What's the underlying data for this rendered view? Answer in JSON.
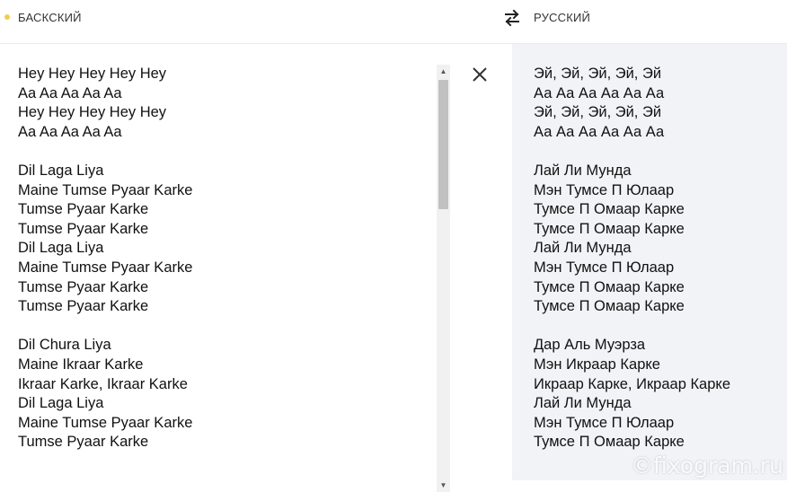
{
  "header": {
    "source_lang": "БАСКСКИЙ",
    "target_lang": "РУССКИЙ"
  },
  "source": {
    "lines": [
      "Hey Hey Hey Hey Hey",
      "Aa Aa Aa Aa Aa",
      "Hey Hey Hey Hey Hey",
      "Aa Aa Aa Aa Aa",
      "",
      "Dil Laga Liya",
      "Maine Tumse Pyaar Karke",
      "Tumse Pyaar Karke",
      "Tumse Pyaar Karke",
      "Dil Laga Liya",
      "Maine Tumse Pyaar Karke",
      "Tumse Pyaar Karke",
      "Tumse Pyaar Karke",
      "",
      "Dil Chura Liya",
      "Maine Ikraar Karke",
      "Ikraar Karke, Ikraar Karke",
      "Dil Laga Liya",
      "Maine Tumse Pyaar Karke",
      "Tumse Pyaar Karke"
    ]
  },
  "translation": {
    "lines": [
      "Эй, Эй, Эй, Эй, Эй",
      "Аа Аа Аа Аа Аа Аа",
      "Эй, Эй, Эй, Эй, Эй",
      "Аа Аа Аа Аа Аа Аа",
      "",
      "Лай Ли Мунда",
      "Мэн Тумсе П Юлаар",
      "Тумсе П Омаар Карке",
      "Тумсе П Омаар Карке",
      "Лай Ли Мунда",
      "Мэн Тумсе П Юлаар",
      "Тумсе П Омаар Карке",
      "Тумсе П Омаар Карке",
      "",
      "Дар Аль Муэрза",
      "Мэн Икраар Карке",
      "Икраар Карке, Икраар Карке",
      "Лай Ли Мунда",
      "Мэн Тумсе П Юлаар",
      "Тумсе П Омаар Карке"
    ]
  },
  "watermark": "©fixogram.ru",
  "colors": {
    "accent_dot": "#f4cc4b",
    "target_background": "#f2f3f7"
  },
  "icons": {
    "swap": "swap-arrows-icon",
    "close": "close-icon",
    "scroll_up": "triangle-up-icon",
    "scroll_down": "triangle-down-icon"
  }
}
